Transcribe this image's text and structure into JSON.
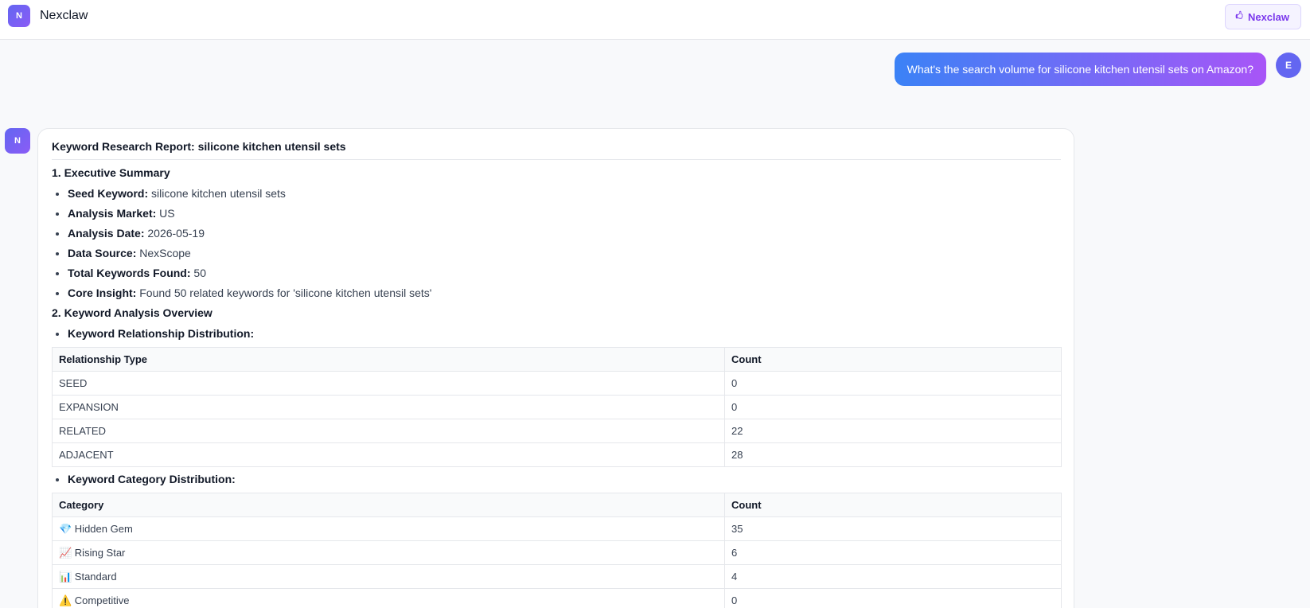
{
  "app": {
    "logo_letter": "N",
    "title": "Nexclaw",
    "top_button_icon": "🖒",
    "top_button_label": "Nexclaw"
  },
  "user_message": {
    "text": "What's the search volume for silicone kitchen utensil sets on Amazon?",
    "avatar": "E"
  },
  "bot": {
    "avatar": "N"
  },
  "report": {
    "title": "Keyword Research Report: silicone kitchen utensil sets",
    "section1_title": "1. Executive Summary",
    "summary": [
      {
        "label": "Seed Keyword:",
        "value": "silicone kitchen utensil sets"
      },
      {
        "label": "Analysis Market:",
        "value": "US"
      },
      {
        "label": "Analysis Date:",
        "value": "2026-05-19"
      },
      {
        "label": "Data Source:",
        "value": "NexScope"
      },
      {
        "label": "Total Keywords Found:",
        "value": "50"
      },
      {
        "label": "Core Insight:",
        "value": "Found 50 related keywords for 'silicone kitchen utensil sets'"
      }
    ],
    "section2_title": "2. Keyword Analysis Overview",
    "relationship": {
      "heading": "Keyword Relationship Distribution:",
      "headers": [
        "Relationship Type",
        "Count"
      ],
      "rows": [
        [
          "SEED",
          "0"
        ],
        [
          "EXPANSION",
          "0"
        ],
        [
          "RELATED",
          "22"
        ],
        [
          "ADJACENT",
          "28"
        ]
      ]
    },
    "category": {
      "heading": "Keyword Category Distribution:",
      "headers": [
        "Category",
        "Count"
      ],
      "rows": [
        [
          "💎 Hidden Gem",
          "35"
        ],
        [
          "📈 Rising Star",
          "6"
        ],
        [
          "📊 Standard",
          "4"
        ],
        [
          "⚠️ Competitive",
          "0"
        ]
      ]
    }
  }
}
